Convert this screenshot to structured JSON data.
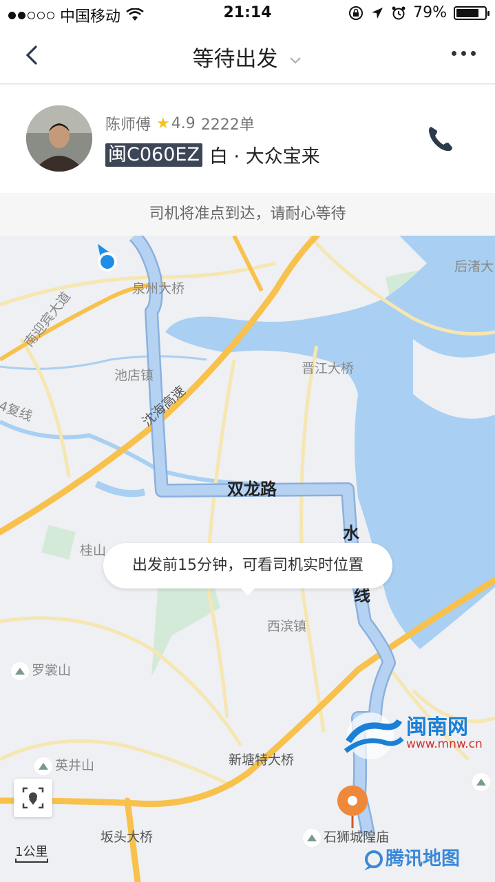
{
  "status_bar": {
    "carrier": "中国移动",
    "time": "21:14",
    "battery": "79%",
    "battery_level": 0.79,
    "signal_strength": 2,
    "icons": [
      "signal-dots-icon",
      "wifi-icon",
      "rotation-lock-icon",
      "location-arrow-icon",
      "alarm-icon",
      "battery-icon"
    ]
  },
  "navbar": {
    "title": "等待出发",
    "back_icon": "chevron-left-icon",
    "dropdown_icon": "chevron-down-icon",
    "more_icon": "more-dots-icon"
  },
  "driver": {
    "name": "陈师傅",
    "rating": "4.9",
    "orders": "2222单",
    "plate": "闽C060EZ",
    "car": "白 · 大众宝来",
    "phone_icon": "phone-icon"
  },
  "notice": "司机将准点到达，请耐心等待",
  "map": {
    "colors": {
      "water": "#a9cff2",
      "land": "#eef0f3",
      "highway": "#f8c14c",
      "route": "#a8c8ee",
      "route_outline": "#8ab0de",
      "destination": "#f0883a"
    },
    "labels": {
      "quanzhou_bridge": "泉州大桥",
      "nanying": "南迎宾大道",
      "houzhu": "后渚大",
      "chidian": "池店镇",
      "jinjiang_bridge": "晋江大桥",
      "shenhai": "沈海高速",
      "fuxian": "4复线",
      "guishan": "桂山",
      "xibin": "西滨镇",
      "luoshang": "罗裳山",
      "yingjing": "英井山",
      "xintang": "新塘特大桥",
      "bantou": "坂头大桥",
      "shishi_temple": "石狮城隍庙"
    },
    "road_labels": {
      "shuanglong": "双龙路",
      "shui": "水",
      "xian": "线"
    },
    "bubble": "出发前15分钟，可看司机实时位置",
    "scale": "1公里",
    "locate_icon": "locate-target-icon",
    "watermark_cn": "闽南网",
    "watermark_url": "www.mnw.cn",
    "provider": "腾讯地图"
  }
}
